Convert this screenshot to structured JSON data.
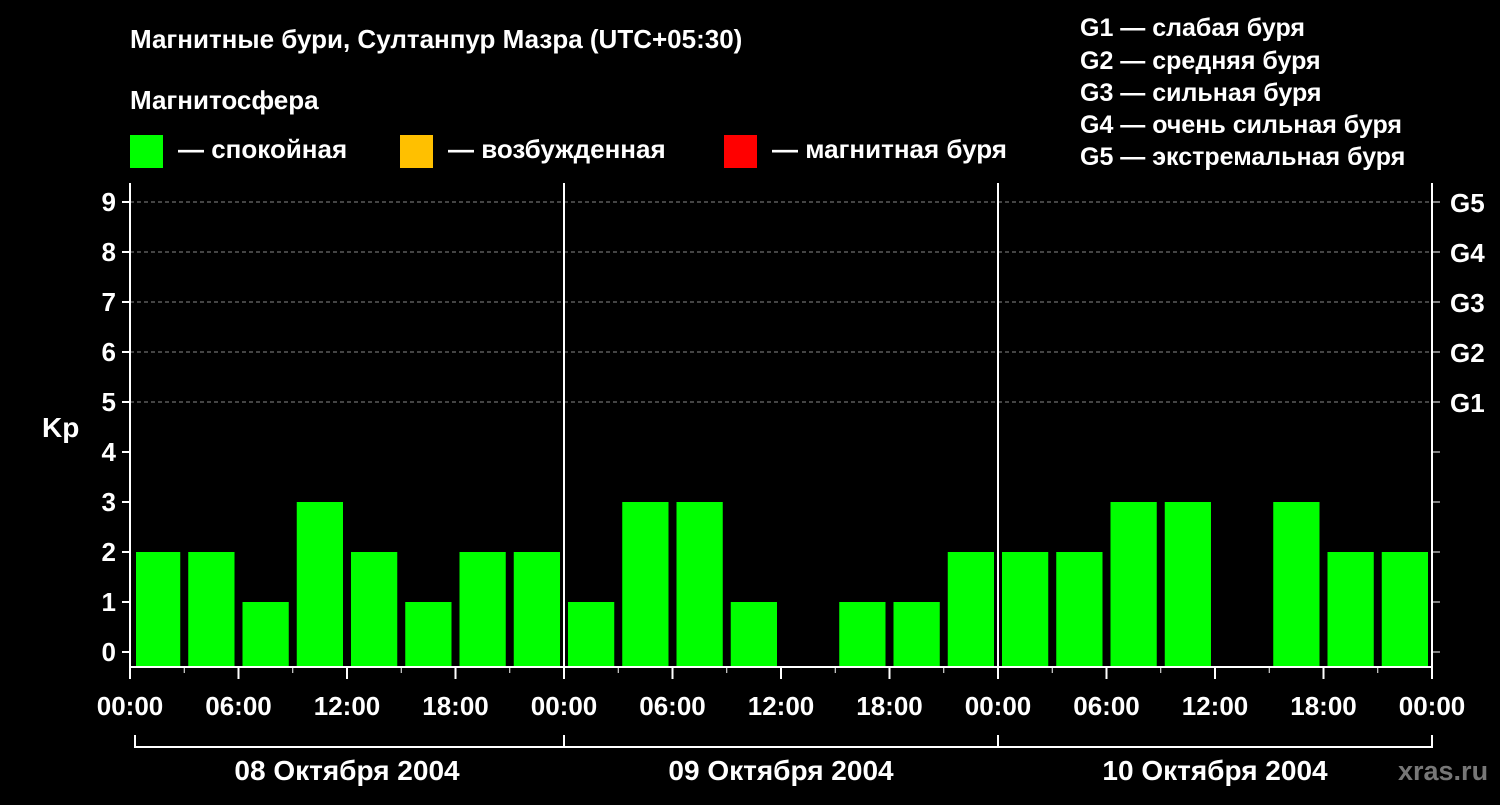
{
  "title": "Магнитные бури, Султанпур Мазра (UTC+05:30)",
  "legend": {
    "heading": "Магнитосфера",
    "items": [
      {
        "label": "— спокойная",
        "color": "#00ff00"
      },
      {
        "label": "— возбужденная",
        "color": "#ffc000"
      },
      {
        "label": "— магнитная буря",
        "color": "#ff0000"
      }
    ]
  },
  "g_scale": [
    "G1 — слабая буря",
    "G2 — средняя буря",
    "G3 — сильная буря",
    "G4 — очень сильная буря",
    "G5 — экстремальная буря"
  ],
  "watermark": "xras.ru",
  "chart_data": {
    "type": "bar",
    "ylabel": "Kp",
    "ylim": [
      0,
      9
    ],
    "y_ticks": [
      "0",
      "1",
      "2",
      "3",
      "4",
      "5",
      "6",
      "7",
      "8",
      "9"
    ],
    "right_ticks": [
      {
        "value": 5,
        "label": "G1"
      },
      {
        "value": 6,
        "label": "G2"
      },
      {
        "value": 7,
        "label": "G3"
      },
      {
        "value": 8,
        "label": "G4"
      },
      {
        "value": 9,
        "label": "G5"
      }
    ],
    "x_tick_labels": [
      "00:00",
      "06:00",
      "12:00",
      "18:00",
      "00:00",
      "06:00",
      "12:00",
      "18:00",
      "00:00",
      "06:00",
      "12:00",
      "18:00",
      "00:00"
    ],
    "days": [
      "08 Октября 2004",
      "09 Октября 2004",
      "10 Октября 2004"
    ],
    "interval_hours": 3,
    "values": [
      2,
      2,
      1,
      3,
      2,
      1,
      2,
      2,
      1,
      3,
      3,
      1,
      0,
      1,
      1,
      2,
      2,
      2,
      3,
      3,
      0,
      3,
      2,
      2
    ],
    "bar_color": "#00ff00",
    "grid": true
  }
}
